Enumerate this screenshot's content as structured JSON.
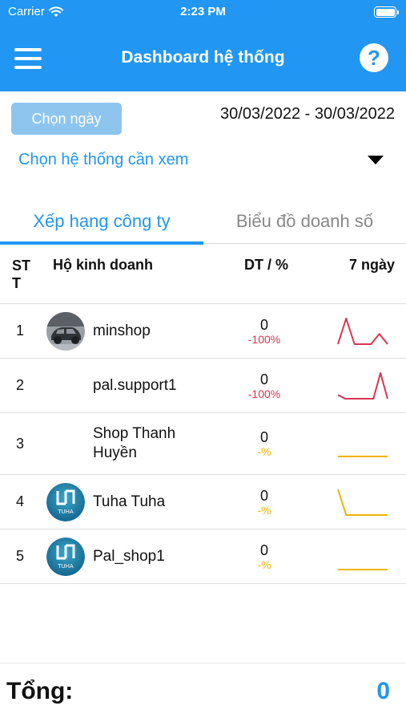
{
  "status_bar": {
    "carrier": "Carrier",
    "time": "2:23 PM"
  },
  "header": {
    "title": "Dashboard hệ thống"
  },
  "filters": {
    "date_button": "Chọn ngày",
    "date_range": "30/03/2022 - 30/03/2022",
    "system_select": "Chọn hệ thống cần xem"
  },
  "tabs": [
    {
      "label": "Xếp hạng công ty",
      "active": true
    },
    {
      "label": "Biểu đồ doanh số",
      "active": false
    }
  ],
  "table": {
    "headers": {
      "stt": "ST T",
      "shop": "Hộ kinh doanh",
      "revenue": "DT / %",
      "week": "7 ngày"
    },
    "rows": [
      {
        "stt": "1",
        "name": "minshop",
        "revenue": "0",
        "percent": "-100%",
        "percent_color": "#d9344f",
        "avatar": "car-photo",
        "trend": [
          0,
          1,
          0,
          0,
          0,
          0.4,
          0
        ]
      },
      {
        "stt": "2",
        "name": "pal.support1",
        "revenue": "0",
        "percent": "-100%",
        "percent_color": "#d9344f",
        "avatar": "",
        "trend": [
          0.15,
          0,
          0,
          0,
          0,
          0,
          1,
          0
        ]
      },
      {
        "stt": "3",
        "name": "Shop Thanh Huyền",
        "revenue": "0",
        "percent": "-%",
        "percent_color": "#f0b400",
        "avatar": "",
        "trend": [
          0,
          0,
          0,
          0,
          0,
          0,
          0
        ]
      },
      {
        "stt": "4",
        "name": "Tuha Tuha",
        "revenue": "0",
        "percent": "-%",
        "percent_color": "#f0b400",
        "avatar": "tuha-logo",
        "trend": [
          1,
          0,
          0,
          0,
          0,
          0,
          0
        ]
      },
      {
        "stt": "5",
        "name": "Pal_shop1",
        "revenue": "0",
        "percent": "-%",
        "percent_color": "#f0b400",
        "avatar": "tuha-logo",
        "trend": [
          0,
          0,
          0,
          0,
          0,
          0,
          0
        ]
      }
    ]
  },
  "logo_text": "TUHA",
  "total": {
    "label": "Tổng:",
    "value": "0"
  },
  "colors": {
    "primary": "#2196f3",
    "negative": "#d9344f",
    "neutral": "#f0b400"
  }
}
